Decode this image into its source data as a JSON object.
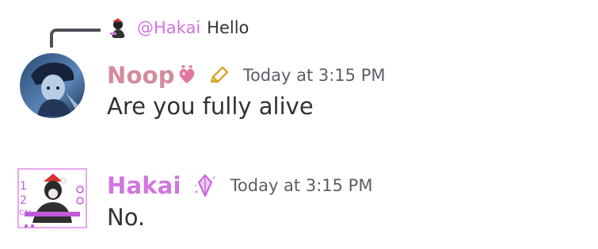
{
  "reply": {
    "mention": "@Hakai",
    "text": "Hello"
  },
  "messages": [
    {
      "username": "Noop",
      "username_color": "#d38b9e",
      "timestamp": "Today at 3:15 PM",
      "content": "Are you fully alive"
    },
    {
      "username": "Hakai",
      "username_color": "#d175e0",
      "timestamp": "Today at 3:15 PM",
      "content": "No."
    }
  ],
  "icons": {
    "noop_emoji": "heart-emoji-icon",
    "noop_tag": "pencil-icon",
    "hakai_tag": "crystal-icon"
  },
  "colors": {
    "mention": "#d175e0",
    "timestamp": "#5c5e66",
    "text": "#2e3338",
    "reply_line": "#4e5058"
  }
}
